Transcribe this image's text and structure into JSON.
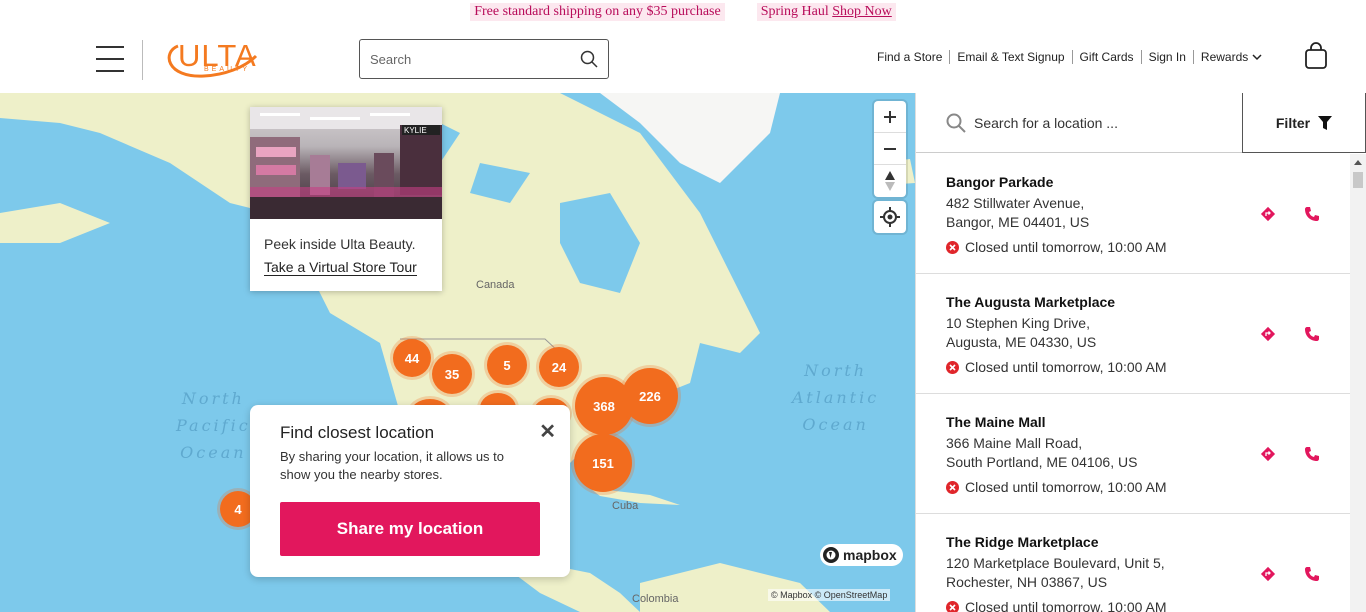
{
  "promo": {
    "shipping": "Free standard shipping on any $35 purchase",
    "haul": "Spring Haul",
    "shop_now": "Shop Now"
  },
  "header": {
    "logo": "ULTA",
    "logo_sub": "BEAUTY",
    "search_placeholder": "Search",
    "links": [
      "Find a Store",
      "Email & Text Signup",
      "Gift Cards",
      "Sign In",
      "Rewards"
    ]
  },
  "map": {
    "country_label": "Canada",
    "cuba_label": "Cuba",
    "colombia_label": "Colombia",
    "north_pacific": "North Pacific Ocean",
    "north_pacific_lines": [
      "North",
      "Pacific",
      "Ocean"
    ],
    "north_atlantic_lines": [
      "North",
      "Atlantic",
      "Ocean"
    ],
    "clusters": [
      "44",
      "35",
      "5",
      "24",
      "368",
      "226",
      "151",
      "4"
    ],
    "attribution": "© Mapbox © OpenStreetMap",
    "mapbox_logo": "mapbox"
  },
  "tour_card": {
    "text": "Peek inside Ulta Beauty.",
    "link": "Take a Virtual Store Tour"
  },
  "location_popup": {
    "title": "Find closest location",
    "body": "By sharing your location, it allows us to show you the nearby stores.",
    "button": "Share my location",
    "close": "✕"
  },
  "panel": {
    "search_placeholder": "Search for a location ...",
    "filter_label": "Filter",
    "stores": [
      {
        "name": "Bangor Parkade",
        "line1": "482 Stillwater Avenue,",
        "line2": "Bangor, ME 04401, US",
        "status": "Closed until tomorrow, 10:00 AM"
      },
      {
        "name": "The Augusta Marketplace",
        "line1": "10 Stephen King Drive,",
        "line2": "Augusta, ME 04330, US",
        "status": "Closed until tomorrow, 10:00 AM"
      },
      {
        "name": "The Maine Mall",
        "line1": "366 Maine Mall Road,",
        "line2": "South Portland, ME 04106, US",
        "status": "Closed until tomorrow, 10:00 AM"
      },
      {
        "name": "The Ridge Marketplace",
        "line1": "120 Marketplace Boulevard, Unit 5,",
        "line2": "Rochester, NH 03867, US",
        "status": "Closed until tomorrow, 10:00 AM"
      }
    ]
  },
  "colors": {
    "brand_orange": "#f47a20",
    "cluster_orange": "#f26c1e",
    "accent_pink": "#e2175d",
    "ocean": "#7dc9eb",
    "land": "#eef0c9"
  }
}
